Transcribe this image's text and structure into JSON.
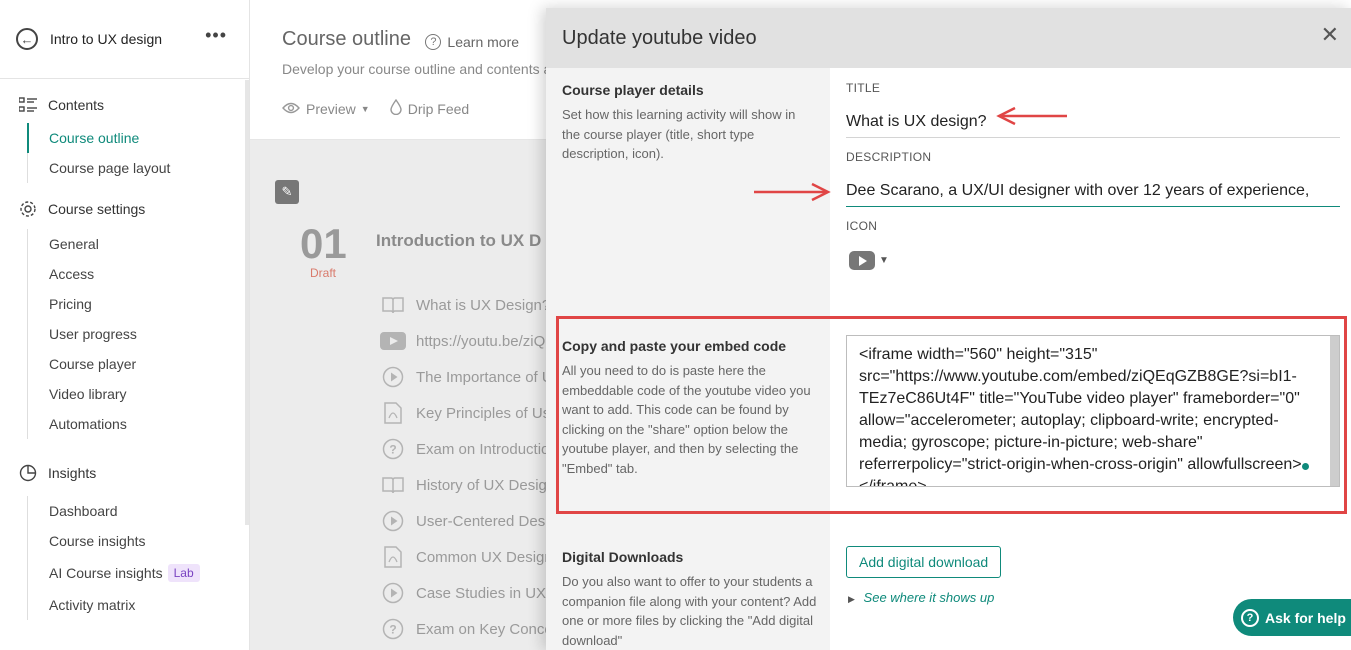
{
  "sidebar": {
    "course_name": "Intro to UX design",
    "sections": [
      {
        "label": "Contents",
        "items": [
          "Course outline",
          "Course page layout"
        ]
      },
      {
        "label": "Course settings",
        "items": [
          "General",
          "Access",
          "Pricing",
          "User progress",
          "Course player",
          "Video library",
          "Automations"
        ]
      },
      {
        "label": "Insights",
        "items": [
          "Dashboard",
          "Course insights",
          "AI Course insights",
          "Activity matrix"
        ]
      }
    ],
    "lab_badge": "Lab"
  },
  "main": {
    "title": "Course outline",
    "learn_more": "Learn more",
    "subtitle": "Develop your course outline and contents a",
    "actions": [
      "Preview",
      "Drip Feed"
    ],
    "module": {
      "number": "01",
      "status": "Draft",
      "title": "Introduction to UX D",
      "lessons": [
        {
          "title": "What is UX Design?",
          "icon": "book-icon"
        },
        {
          "title": "https://youtu.be/ziQ",
          "icon": "youtube-icon"
        },
        {
          "title": "The Importance of U",
          "icon": "play-circle-icon"
        },
        {
          "title": "Key Principles of Us",
          "icon": "pdf-icon"
        },
        {
          "title": "Exam on Introductio",
          "icon": "question-icon"
        },
        {
          "title": "History of UX Desig",
          "icon": "book-icon"
        },
        {
          "title": "User-Centered Desi",
          "icon": "play-circle-icon"
        },
        {
          "title": "Common UX Design",
          "icon": "pdf-icon"
        },
        {
          "title": "Case Studies in UX D",
          "icon": "play-circle-icon"
        },
        {
          "title": "Exam on Key Conce",
          "icon": "question-icon"
        }
      ]
    }
  },
  "panel": {
    "title": "Update youtube video",
    "player_details": {
      "heading": "Course player details",
      "description": "Set how this learning activity will show in the course player (title, short type description, icon).",
      "title_label": "TITLE",
      "title_value": "What is UX design?",
      "description_label": "DESCRIPTION",
      "description_value": "Dee Scarano, a UX/UI designer with over 12 years of experience,",
      "icon_label": "ICON"
    },
    "embed": {
      "heading": "Copy and paste your embed code",
      "description": "All you need to do is paste here the embeddable code of the youtube video you want to add. This code can be found by clicking on the \"share\" option below the youtube player, and then by selecting the \"Embed\" tab.",
      "code": "<iframe width=\"560\" height=\"315\" src=\"https://www.youtube.com/embed/ziQEqGZB8GE?si=bI1-TEz7eC86Ut4F\" title=\"YouTube video player\" frameborder=\"0\" allow=\"accelerometer; autoplay; clipboard-write; encrypted-media; gyroscope; picture-in-picture; web-share\" referrerpolicy=\"strict-origin-when-cross-origin\" allowfullscreen></iframe>"
    },
    "downloads": {
      "heading": "Digital Downloads",
      "description": "Do you also want to offer to your students a companion file along with your content? Add one or more files by clicking the \"Add digital download\"",
      "button": "Add digital download",
      "see_where": "See where it shows up"
    }
  },
  "help_button": "Ask for help",
  "colors": {
    "accent": "#0f8a7b",
    "annotation": "#e04545",
    "draft": "#d97a6c"
  }
}
